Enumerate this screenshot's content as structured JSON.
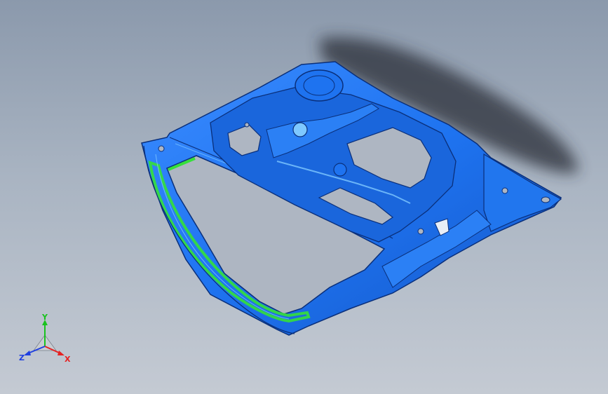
{
  "viewport": {
    "background_top": "#8b99ac",
    "background_bottom": "#c4cad3"
  },
  "model": {
    "body_color": "#1e73f0",
    "edge_color": "#0a2f7a",
    "highlight_color": "#7ec8ff",
    "selected_face_color": "#35e03a"
  },
  "triad": {
    "x_label": "X",
    "y_label": "Y",
    "z_label": "Z",
    "x_color": "#e52222",
    "y_color": "#19c21e",
    "z_color": "#1f3fe0"
  }
}
